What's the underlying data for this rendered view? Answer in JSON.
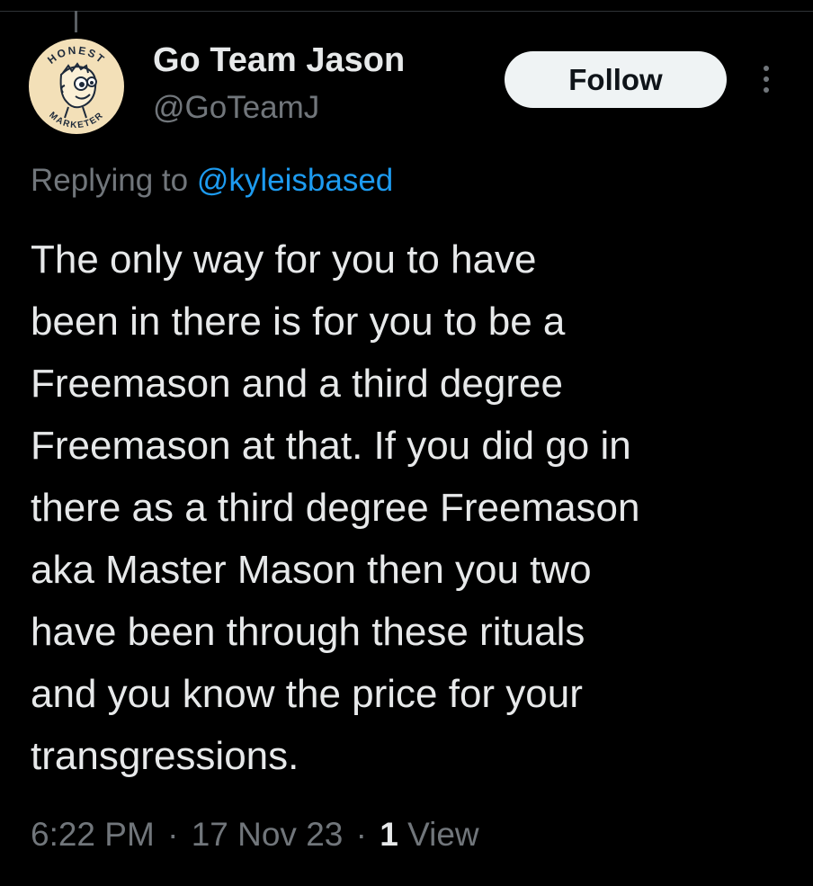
{
  "tweet": {
    "author": {
      "display_name": "Go Team Jason",
      "handle": "@GoTeamJ",
      "avatar_icon": "honest-marketer-logo",
      "avatar_text_top": "HONEST",
      "avatar_text_bottom": "MARKETER"
    },
    "follow_label": "Follow",
    "more_icon": "more-vertical-icon",
    "reply": {
      "prefix": "Replying to",
      "target": "@kyleisbased"
    },
    "text_lines": [
      "The only way for you to have",
      "been in there is for you to be a",
      "Freemason and a third degree",
      "Freemason at that. If you did go in",
      "there as a third degree Freemason",
      "aka Master Mason then you two",
      "have been through these rituals",
      "and you know the price for your",
      "transgressions."
    ],
    "meta": {
      "time": "6:22 PM",
      "separator": "·",
      "date": "17 Nov 23",
      "views_count": "1",
      "views_label": "View"
    }
  },
  "colors": {
    "background": "#000000",
    "primary_text": "#e7e9ea",
    "secondary_text": "#71767b",
    "link": "#1d9bf0",
    "follow_button_bg": "#eff3f4",
    "follow_button_text": "#0f1419",
    "avatar_bg": "#f3e0b8"
  }
}
